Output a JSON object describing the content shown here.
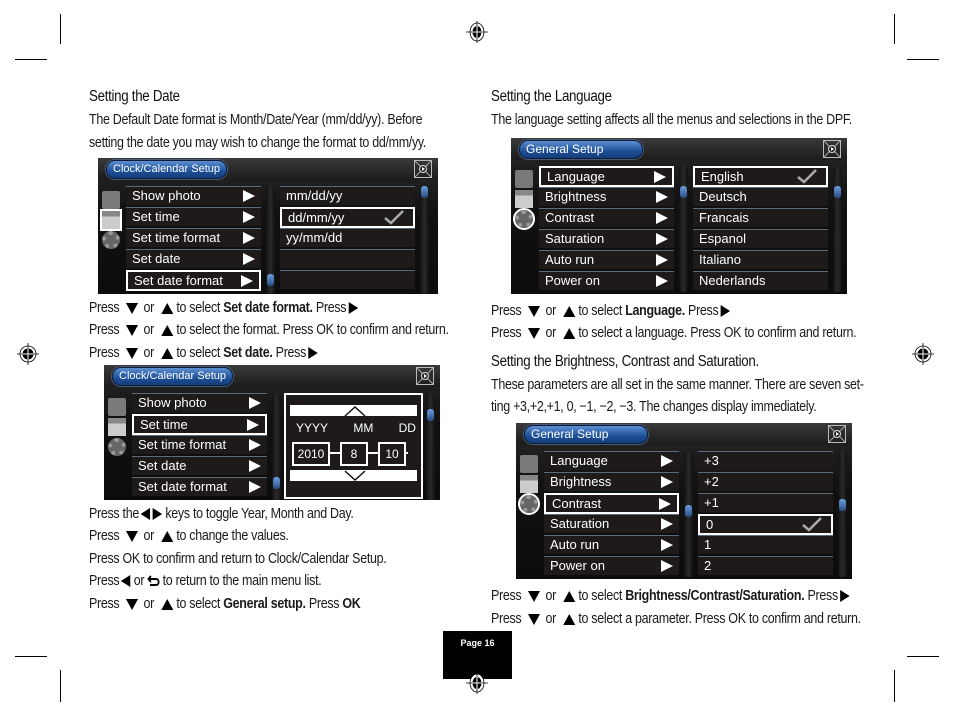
{
  "page": {
    "page_label": "Page 16"
  },
  "left": {
    "date_heading": "Setting the Date",
    "date_intro": [
      "The Default Date format is Month/Date/Year (mm/dd/yy). Before",
      "setting the date you may wish to change the format to dd/mm/yy."
    ],
    "screen1": {
      "title": "Clock/Calendar Setup",
      "menu": [
        "Show photo",
        "Set time",
        "Set time format",
        "Set date",
        "Set date format"
      ],
      "selected_menu_index": 4,
      "active_side_icon": "calendar-icon",
      "options": [
        "mm/dd/yy",
        "dd/mm/yy",
        "yy/mm/dd",
        "",
        ""
      ],
      "selected_option_index": 1,
      "checked_option": "dd/mm/yy"
    },
    "instr1": {
      "l1_a": "Press",
      "l1_b": "or",
      "l1_c": "to select",
      "l1_bold": "Set date format.",
      "l1_d": "Press",
      "l2_a": "Press",
      "l2_b": "or",
      "l2_c": "to select the format. Press OK to confirm and return.",
      "l3_a": "Press",
      "l3_b": "or",
      "l3_c": "to select",
      "l3_bold": "Set date.",
      "l3_d": "Press"
    },
    "screen2": {
      "title": "Clock/Calendar Setup",
      "menu": [
        "Show photo",
        "Set time",
        "Set time format",
        "Set date",
        "Set date format"
      ],
      "selected_menu_index": 1,
      "date_labels": [
        "YYYY",
        "MM",
        "DD"
      ],
      "date_values": [
        "2010",
        "8",
        "10"
      ]
    },
    "instr2": {
      "l1_a": "Press the",
      "l1_b": "keys to toggle Year, Month and Day.",
      "l2_a": "Press",
      "l2_b": "or",
      "l2_c": "to change the values.",
      "l3": "Press OK to confirm and return to Clock/Calendar Setup.",
      "l4_a": "Press",
      "l4_b": "or",
      "l4_c": "to return to the main menu list.",
      "l5_a": "Press",
      "l5_b": "or",
      "l5_c": "to select",
      "l5_bold": "General setup.",
      "l5_d": "Press",
      "l5_bold2": "OK"
    }
  },
  "right": {
    "lang_heading": "Setting the Language",
    "lang_intro": "The language setting affects all the menus and selections in the DPF.",
    "screen3": {
      "title": "General Setup",
      "menu": [
        "Language",
        "Brightness",
        "Contrast",
        "Saturation",
        "Auto run",
        "Power on"
      ],
      "selected_menu_index": 0,
      "active_side_icon": "gear-icon",
      "options": [
        "English",
        "Deutsch",
        "Francais",
        "Espanol",
        "Italiano",
        "Nederlands"
      ],
      "selected_option_index": 0,
      "checked_option": "English"
    },
    "instr3": {
      "l1_a": "Press",
      "l1_b": "or",
      "l1_c": "to select",
      "l1_bold": "Language.",
      "l1_d": "Press",
      "l2_a": "Press",
      "l2_b": "or",
      "l2_c": "to select a language. Press OK to confirm and return."
    },
    "bcs_heading": "Setting the Brightness, Contrast and Saturation.",
    "bcs_intro": [
      "These parameters are all set in the same manner. There are seven set-",
      "ting +3,+2,+1, 0, −1, −2, −3. The changes display immediately."
    ],
    "screen4": {
      "title": "General Setup",
      "menu": [
        "Language",
        "Brightness",
        "Contrast",
        "Saturation",
        "Auto run",
        "Power on"
      ],
      "selected_menu_index": 2,
      "active_side_icon": "gear-icon",
      "options": [
        "+3",
        "+2",
        "+1",
        "0",
        "1",
        "2"
      ],
      "selected_option_index": 3,
      "checked_option": "0"
    },
    "instr4": {
      "l1_a": "Press",
      "l1_b": "or",
      "l1_c": "to select",
      "l1_bold": "Brightness/Contrast/Saturation.",
      "l1_d": "Press",
      "l2_a": "Press",
      "l2_b": "or",
      "l2_c": "to select a parameter. Press OK to confirm and return."
    }
  }
}
